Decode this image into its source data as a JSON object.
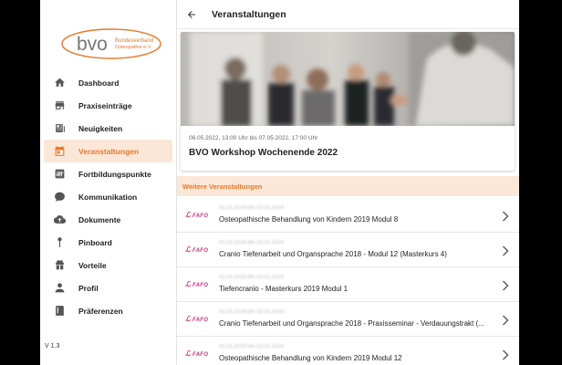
{
  "sidebar": {
    "logo": {
      "brand": "bvo",
      "line1": "Bundesverband",
      "line2": "Osteopathie e.V."
    },
    "items": [
      {
        "label": "Dashboard",
        "icon": "home-icon",
        "active": false
      },
      {
        "label": "Praxiseinträge",
        "icon": "store-icon",
        "active": false
      },
      {
        "label": "Neuigkeiten",
        "icon": "newspaper-icon",
        "active": false
      },
      {
        "label": "Veranstaltungen",
        "icon": "calendar-icon",
        "active": true
      },
      {
        "label": "Fortbildungspunkte",
        "icon": "tally-icon",
        "active": false
      },
      {
        "label": "Kommunikation",
        "icon": "chat-icon",
        "active": false
      },
      {
        "label": "Dokumente",
        "icon": "cloud-icon",
        "active": false
      },
      {
        "label": "Pinboard",
        "icon": "pin-icon",
        "active": false
      },
      {
        "label": "Vorteile",
        "icon": "gift-icon",
        "active": false
      },
      {
        "label": "Profil",
        "icon": "person-icon",
        "active": false
      },
      {
        "label": "Präferenzen",
        "icon": "book-icon",
        "active": false
      }
    ],
    "version": "V 1.3"
  },
  "header": {
    "title": "Veranstaltungen",
    "back_icon": "arrow-back-icon"
  },
  "featured": {
    "date": "06.05.2022, 13:00 Uhr bis 07.05.2022, 17:00 Uhr",
    "title": "BVO Workshop Wochenende 2022"
  },
  "section": {
    "title": "Weitere Veranstaltungen"
  },
  "events": [
    {
      "badge": "FAFO",
      "date": "01.01.2019 bis 02.01.2019",
      "title": "Osteopathische Behandlung von Kindern 2019 Modul 8"
    },
    {
      "badge": "FAFO",
      "date": "01.01.2018 bis 02.01.2018",
      "title": "Cranio Tiefenarbeit und Organsprache 2018 - Modul 12 (Masterkurs 4)"
    },
    {
      "badge": "FAFO",
      "date": "01.01.2019 bis 02.01.2019",
      "title": "Tiefencranio - Masterkurs 2019 Modul 1"
    },
    {
      "badge": "FAFO",
      "date": "01.01.2018 bis 02.01.2018",
      "title": "Cranio Tiefenarbeit und Organsprache 2018 - Praxisseminar - Verdauungstrakt (..."
    },
    {
      "badge": "FAFO",
      "date": "01.01.2019 bis 02.01.2019",
      "title": "Osteopathische Behandlung von Kindern 2019 Modul 12"
    }
  ],
  "colors": {
    "accent": "#e7782c",
    "active_bg": "#fbe7d7",
    "badge": "#c8307c"
  }
}
